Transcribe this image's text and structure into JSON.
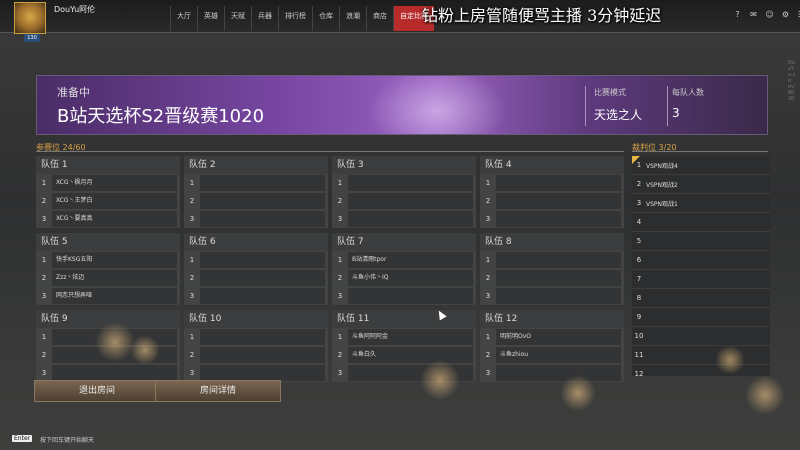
{
  "header": {
    "username": "DouYu阿伦",
    "level": "130",
    "nav": [
      "大厅",
      "英雄",
      "天赋",
      "兵器",
      "排行榜",
      "仓库",
      "浪潮",
      "商店",
      "自定比赛"
    ],
    "active_nav": "自定比赛",
    "overlay_text": "钻粉上房管随便骂主播 3分钟延迟",
    "icons": [
      "help-icon",
      "mail-icon",
      "friends-icon",
      "settings-icon",
      "menu-icon"
    ]
  },
  "watermark": "DouYu.com/8020",
  "banner": {
    "status": "准备中",
    "title": "B站天选杯S2晋级赛1020",
    "mode_label": "比赛模式",
    "mode_value": "天选之人",
    "per_team_label": "每队人数",
    "per_team_value": "3"
  },
  "slots_label": "参赛位 24/60",
  "judges_label": "裁判位 3/20",
  "teams": [
    {
      "name": "队伍 1",
      "slots": [
        {
          "num": "1",
          "player": "XCG丶枫月月"
        },
        {
          "num": "2",
          "player": "XCG丶王梦白"
        },
        {
          "num": "3",
          "player": "XCG丶要真真"
        }
      ]
    },
    {
      "name": "队伍 2",
      "slots": [
        {
          "num": "1",
          "player": ""
        },
        {
          "num": "2",
          "player": ""
        },
        {
          "num": "3",
          "player": ""
        }
      ]
    },
    {
      "name": "队伍 3",
      "slots": [
        {
          "num": "1",
          "player": ""
        },
        {
          "num": "2",
          "player": ""
        },
        {
          "num": "3",
          "player": ""
        }
      ]
    },
    {
      "name": "队伍 4",
      "slots": [
        {
          "num": "1",
          "player": ""
        },
        {
          "num": "2",
          "player": ""
        },
        {
          "num": "3",
          "player": ""
        }
      ]
    },
    {
      "name": "队伍 5",
      "slots": [
        {
          "num": "1",
          "player": "快手KSG五阳"
        },
        {
          "num": "2",
          "player": "Zzz丶炫迈"
        },
        {
          "num": "3",
          "player": "网恋只想弄哑"
        }
      ]
    },
    {
      "name": "队伍 6",
      "slots": [
        {
          "num": "1",
          "player": ""
        },
        {
          "num": "2",
          "player": ""
        },
        {
          "num": "3",
          "player": ""
        }
      ]
    },
    {
      "name": "队伍 7",
      "slots": [
        {
          "num": "1",
          "player": "B站清雨tpor"
        },
        {
          "num": "2",
          "player": "斗鱼小伟丶IQ"
        },
        {
          "num": "3",
          "player": ""
        }
      ]
    },
    {
      "name": "队伍 8",
      "slots": [
        {
          "num": "1",
          "player": ""
        },
        {
          "num": "2",
          "player": ""
        },
        {
          "num": "3",
          "player": ""
        }
      ]
    },
    {
      "name": "队伍 9",
      "slots": [
        {
          "num": "1",
          "player": ""
        },
        {
          "num": "2",
          "player": ""
        },
        {
          "num": "3",
          "player": ""
        }
      ]
    },
    {
      "name": "队伍 10",
      "slots": [
        {
          "num": "1",
          "player": ""
        },
        {
          "num": "2",
          "player": ""
        },
        {
          "num": "3",
          "player": ""
        }
      ]
    },
    {
      "name": "队伍 11",
      "slots": [
        {
          "num": "1",
          "player": "斗鱼阿阿阿金"
        },
        {
          "num": "2",
          "player": "斗鱼白久"
        },
        {
          "num": "3",
          "player": ""
        }
      ]
    },
    {
      "name": "队伍 12",
      "slots": [
        {
          "num": "1",
          "player": "明前明OvO"
        },
        {
          "num": "2",
          "player": "斗鱼zhiou"
        },
        {
          "num": "3",
          "player": ""
        }
      ]
    }
  ],
  "judges": [
    {
      "num": "1",
      "name": "VSPN观战4"
    },
    {
      "num": "2",
      "name": "VSPN观战2"
    },
    {
      "num": "3",
      "name": "VSPN观战1"
    },
    {
      "num": "4",
      "name": ""
    },
    {
      "num": "5",
      "name": ""
    },
    {
      "num": "6",
      "name": ""
    },
    {
      "num": "7",
      "name": ""
    },
    {
      "num": "8",
      "name": ""
    },
    {
      "num": "9",
      "name": ""
    },
    {
      "num": "10",
      "name": ""
    },
    {
      "num": "11",
      "name": ""
    },
    {
      "num": "12",
      "name": ""
    }
  ],
  "buttons": {
    "exit": "退出房间",
    "details": "房间详情"
  },
  "chat": {
    "key": "Enter",
    "hint": "按下回车键开始聊天"
  },
  "colors": {
    "accent": "#d9a04a",
    "active_tab": "#b82b2b",
    "banner": "#7a48a6"
  }
}
